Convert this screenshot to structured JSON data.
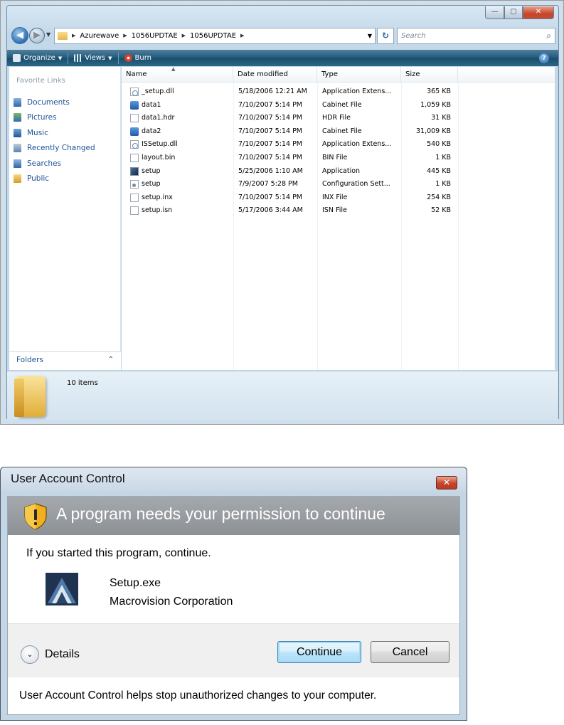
{
  "explorer": {
    "caption_buttons": {
      "minimize": "—",
      "maximize": "▢",
      "close": "✕"
    },
    "address": {
      "crumbs": [
        "Azurewave",
        "1056UPDTAE",
        "1056UPDTAE"
      ],
      "search_placeholder": "Search"
    },
    "toolbar": {
      "organize": "Organize",
      "views": "Views",
      "burn": "Burn",
      "help": "?"
    },
    "nav": {
      "title": "Favorite Links",
      "links": [
        "Documents",
        "Pictures",
        "Music",
        "Recently Changed",
        "Searches",
        "Public"
      ],
      "folders_label": "Folders"
    },
    "columns": {
      "name": "Name",
      "date": "Date modified",
      "type": "Type",
      "size": "Size"
    },
    "files": [
      {
        "name": "_setup.dll",
        "date": "5/18/2006 12:21 AM",
        "type": "Application Extens...",
        "size": "365 KB",
        "icon": "dll"
      },
      {
        "name": "data1",
        "date": "7/10/2007 5:14 PM",
        "type": "Cabinet File",
        "size": "1,059 KB",
        "icon": "cab"
      },
      {
        "name": "data1.hdr",
        "date": "7/10/2007 5:14 PM",
        "type": "HDR File",
        "size": "31 KB",
        "icon": "doc"
      },
      {
        "name": "data2",
        "date": "7/10/2007 5:14 PM",
        "type": "Cabinet File",
        "size": "31,009 KB",
        "icon": "cab"
      },
      {
        "name": "ISSetup.dll",
        "date": "7/10/2007 5:14 PM",
        "type": "Application Extens...",
        "size": "540 KB",
        "icon": "dll"
      },
      {
        "name": "layout.bin",
        "date": "7/10/2007 5:14 PM",
        "type": "BIN File",
        "size": "1 KB",
        "icon": "doc"
      },
      {
        "name": "setup",
        "date": "5/25/2006 1:10 AM",
        "type": "Application",
        "size": "445 KB",
        "icon": "setup"
      },
      {
        "name": "setup",
        "date": "7/9/2007 5:28 PM",
        "type": "Configuration Sett...",
        "size": "1 KB",
        "icon": "cfg"
      },
      {
        "name": "setup.inx",
        "date": "7/10/2007 5:14 PM",
        "type": "INX File",
        "size": "254 KB",
        "icon": "doc"
      },
      {
        "name": "setup.isn",
        "date": "5/17/2006 3:44 AM",
        "type": "ISN File",
        "size": "52 KB",
        "icon": "doc"
      }
    ],
    "status": {
      "items_count": "10 items"
    }
  },
  "uac": {
    "title": "User Account Control",
    "close_glyph": "✕",
    "heading": "A program needs your permission to continue",
    "message": "If you started this program, continue.",
    "program_name": "Setup.exe",
    "publisher": "Macrovision Corporation",
    "details_label": "Details",
    "continue_label": "Continue",
    "cancel_label": "Cancel",
    "footer": "User Account Control helps stop unauthorized changes to your computer."
  },
  "colors": {
    "link_blue": "#1c5296",
    "toolbar_dark": "#225879",
    "uac_banner": "#9a9ea3",
    "close_red": "#c7452a"
  }
}
